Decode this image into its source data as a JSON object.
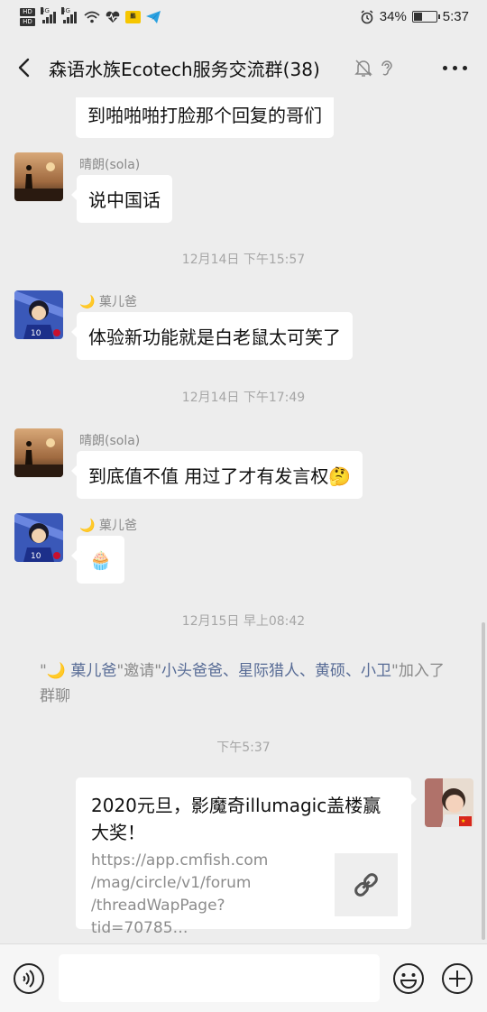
{
  "status_bar": {
    "hd1": "HD",
    "hd2": "HD",
    "net1": "4G",
    "net2": "4G",
    "badge": "酷",
    "battery_percent": "34%",
    "battery_level": 0.34,
    "time": "5:37"
  },
  "header": {
    "title": "森语水族Ecotech服务交流群(38)",
    "icons": [
      "back-icon",
      "mute-icon",
      "ear-icon",
      "more-icon"
    ]
  },
  "messages": {
    "m0": {
      "text": "到啪啪啪打脸那个回复的哥们"
    },
    "m1": {
      "sender": "晴朗(sola)",
      "text": "说中国话"
    },
    "t1": "12月14日 下午15:57",
    "m2": {
      "sender": "🌙 菓儿爸",
      "text": "体验新功能就是白老鼠太可笑了"
    },
    "t2": "12月14日 下午17:49",
    "m3": {
      "sender": "晴朗(sola)",
      "text": "到底值不值 用过了才有发言权🤔"
    },
    "m4": {
      "sender": "🌙 菓儿爸",
      "sticker": "🧁"
    },
    "t3": "12月15日 早上08:42",
    "system": {
      "q1": "\"",
      "inviter": "🌙 菓儿爸",
      "q2": "\"邀请\"",
      "invitees": "小头爸爸、星际猎人、黄硕、小卫",
      "q3": "\"加入了群聊"
    },
    "t4": "下午5:37",
    "card": {
      "title": "2020元旦，影魔奇illumagic盖楼赢大奖！",
      "desc": "https://app.cmfish.com\n/mag/circle/v1/forum\n/threadWapPage?tid=70785…"
    }
  },
  "input_bar": {
    "placeholder": "",
    "icons": [
      "voice-icon",
      "emoji-icon",
      "plus-icon"
    ]
  }
}
